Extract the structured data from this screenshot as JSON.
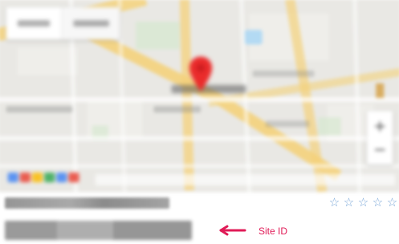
{
  "map": {
    "pin_color": "#ea2b2b",
    "water_color": "#a8d6f4",
    "road_color": "#f4d27b",
    "land_color": "#e9e8e4",
    "park_color": "#cfe8c8",
    "logo_colors": [
      "#4285f4",
      "#ea4335",
      "#fbbc05",
      "#34a853",
      "#4285f4",
      "#ea4335"
    ]
  },
  "location": {
    "name": "",
    "rating": {
      "value": 0,
      "max": 5,
      "symbol_empty": "☆",
      "symbol_filled": "★"
    },
    "site_id_value": ""
  },
  "annotation": {
    "label": "Site ID",
    "color": "#e01b57",
    "icon": "left-arrow-icon"
  }
}
